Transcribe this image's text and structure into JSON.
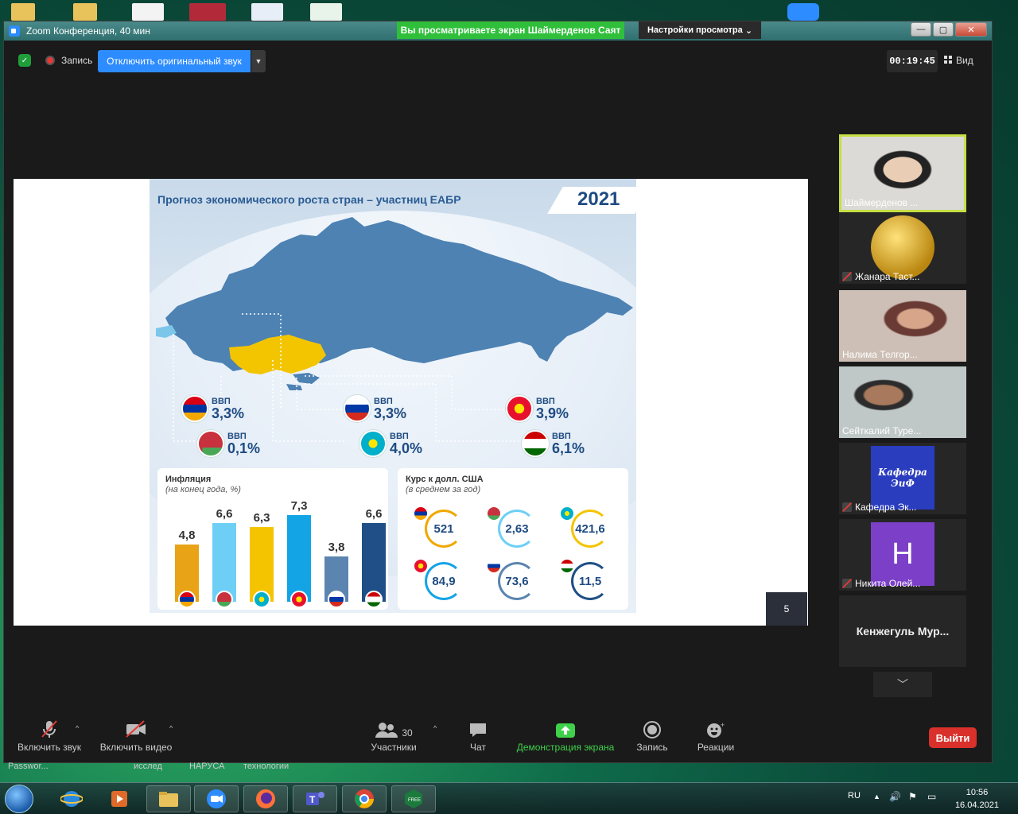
{
  "window": {
    "title": "Zoom Конференция, 40 мин",
    "share_banner": "Вы просматриваете экран Шаймерденов Саят",
    "view_settings": "Настройки просмотра",
    "min": "—",
    "max": "▢",
    "close": "✕"
  },
  "topbar": {
    "record_label": "Запись",
    "original_sound_label": "Отключить оригинальный звук",
    "timer": "00:19:45",
    "view_label": "Вид"
  },
  "slide": {
    "title": "Прогноз экономического роста стран – участниц ЕАБР",
    "year": "2021",
    "page_number": "5",
    "gdp_label": "ВВП",
    "gdp": [
      {
        "country": "Armenia",
        "value": "3,3%"
      },
      {
        "country": "Russia",
        "value": "3,3%"
      },
      {
        "country": "Kyrgyzstan",
        "value": "3,9%"
      },
      {
        "country": "Belarus",
        "value": "0,1%"
      },
      {
        "country": "Kazakhstan",
        "value": "4,0%"
      },
      {
        "country": "Tajikistan",
        "value": "6,1%"
      }
    ],
    "inflation": {
      "title": "Инфляция",
      "subtitle": "(на конец года, %)",
      "bars": [
        {
          "country": "Armenia",
          "value": "4,8",
          "num": 4.8,
          "color": "#e8a317"
        },
        {
          "country": "Belarus",
          "value": "6,6",
          "num": 6.6,
          "color": "#6ecff6"
        },
        {
          "country": "Kazakhstan",
          "value": "6,3",
          "num": 6.3,
          "color": "#f5c400"
        },
        {
          "country": "Kyrgyzstan",
          "value": "7,3",
          "num": 7.3,
          "color": "#13a4e6"
        },
        {
          "country": "Russia",
          "value": "3,8",
          "num": 3.8,
          "color": "#5b85b0"
        },
        {
          "country": "Tajikistan",
          "value": "6,6",
          "num": 6.6,
          "color": "#1f4f86"
        }
      ]
    },
    "rates": {
      "title": "Курс к долл. США",
      "subtitle": "(в среднем за год)",
      "items": [
        {
          "country": "Armenia",
          "value": "521",
          "color": "#f0a800"
        },
        {
          "country": "Belarus",
          "value": "2,63",
          "color": "#6ecff6"
        },
        {
          "country": "Kazakhstan",
          "value": "421,6",
          "color": "#f5c400"
        },
        {
          "country": "Kyrgyzstan",
          "value": "84,9",
          "color": "#13a4e6"
        },
        {
          "country": "Russia",
          "value": "73,6",
          "color": "#5b85b0"
        },
        {
          "country": "Tajikistan",
          "value": "11,5",
          "color": "#1f4f86"
        }
      ]
    }
  },
  "participants": [
    {
      "name": "Шаймерденов ...",
      "active": true,
      "muted": false
    },
    {
      "name": "Жанара Таст...",
      "muted": true
    },
    {
      "name": "Налима Телгор...",
      "muted": false
    },
    {
      "name": "Сейткалий Туре...",
      "muted": false
    },
    {
      "name": "Кафедра Эк...",
      "muted": true,
      "avatar_text": "Кафедра ЭиФ"
    },
    {
      "name": "Никита Олей...",
      "muted": true,
      "avatar_text": "H"
    },
    {
      "name": "Кенжегуль  Мур..."
    }
  ],
  "toolbar": {
    "audio": "Включить звук",
    "video": "Включить видео",
    "participants": "Участники",
    "participants_count": "30",
    "chat": "Чат",
    "share": "Демонстрация экрана",
    "record": "Запись",
    "reactions": "Реакции",
    "leave": "Выйти"
  },
  "desktop_labels": [
    "Passwor...",
    "исслед",
    "НАРУСА",
    "технологии"
  ],
  "taskbar": {
    "lang": "RU",
    "time": "10:56",
    "date": "16.04.2021"
  }
}
